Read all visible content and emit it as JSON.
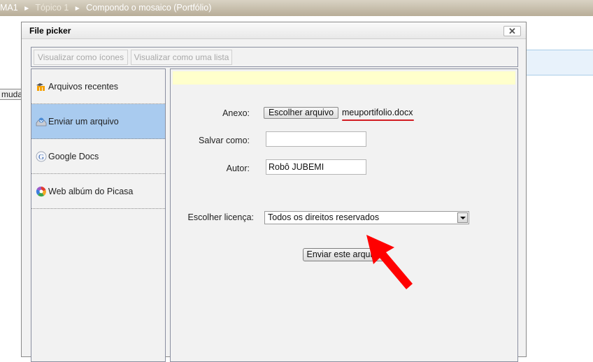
{
  "navbar": {
    "crumbs": [
      {
        "label": "MA1",
        "dim": false
      },
      {
        "label": "Tópico 1",
        "dim": true
      },
      {
        "label": "Compondo o mosaico (Portfólio)",
        "dim": false
      }
    ],
    "separator": "►"
  },
  "background": {
    "button_label": "mudar"
  },
  "dialog": {
    "title": "File picker",
    "close_label": "✕",
    "toolbar": {
      "view_icons_label": "Visualizar como ícones",
      "view_list_label": "Visualizar como uma lista"
    },
    "repositories": [
      {
        "label": "Arquivos recentes",
        "icon": "moodle-icon",
        "active": false
      },
      {
        "label": "Enviar um arquivo",
        "icon": "upload-icon",
        "active": true
      },
      {
        "label": "Google Docs",
        "icon": "google-icon",
        "active": false
      },
      {
        "label": "Web albúm do Picasa",
        "icon": "picasa-icon",
        "active": false
      }
    ],
    "upload_form": {
      "attachment_label": "Anexo:",
      "choose_file_label": "Escolher arquivo",
      "chosen_file": "meuportifolio.docx",
      "save_as_label": "Salvar como:",
      "save_as_value": "",
      "author_label": "Autor:",
      "author_value": "Robô JUBEMI",
      "license_label": "Escolher licença:",
      "license_selected": "Todos os direitos reservados",
      "submit_label": "Enviar este arquivo"
    },
    "annotation": {
      "arrow_color": "#ff0000",
      "underline_color": "#d21d24"
    }
  }
}
